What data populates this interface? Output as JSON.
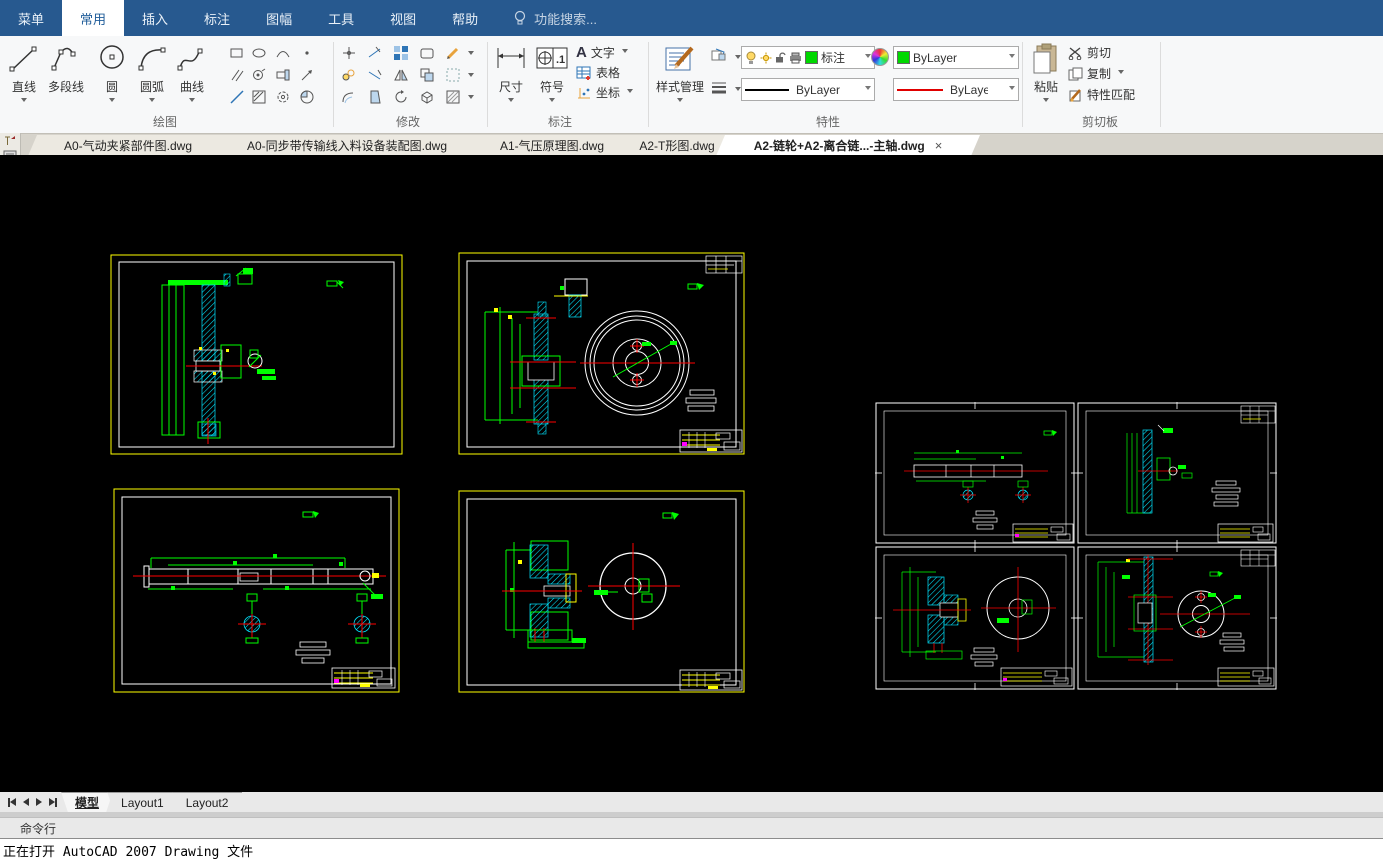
{
  "menu": {
    "items": [
      "菜单",
      "常用",
      "插入",
      "标注",
      "图幅",
      "工具",
      "视图",
      "帮助"
    ],
    "active_item": "常用",
    "search_placeholder": "功能搜索..."
  },
  "ribbon": {
    "draw": {
      "label": "绘图",
      "line": "直线",
      "polyline": "多段线",
      "circle": "圆",
      "arc": "圆弧",
      "curve": "曲线"
    },
    "modify": {
      "label": "修改"
    },
    "annotate": {
      "label": "标注",
      "dimension": "尺寸",
      "symbol": "符号",
      "symbol_icon_text": ".1",
      "text_icon": "A",
      "text": "文字",
      "table": "表格",
      "coordinate": "坐标"
    },
    "properties": {
      "label": "特性",
      "style_manager": "样式管理",
      "layer_value": "标注",
      "color_value": "ByLayer",
      "linetype_value": "ByLayer",
      "lineweight_value": "ByLayer"
    },
    "clipboard": {
      "label": "剪切板",
      "paste": "粘贴",
      "cut": "剪切",
      "copy": "复制",
      "match_properties": "特性匹配"
    }
  },
  "document_tabs": {
    "tabs": [
      {
        "label": "A0-气动夹紧部件图.dwg"
      },
      {
        "label": "A0-同步带传输线入料设备装配图.dwg"
      },
      {
        "label": "A1-气压原理图.dwg"
      },
      {
        "label": "A2-T形图.dwg"
      },
      {
        "label": "A2-链轮+A2-离合链...-主轴.dwg"
      }
    ],
    "active_label": "A2-链轮+A2-离合链...-主轴.dwg",
    "close_glyph": "×"
  },
  "layout_tabs": {
    "model": "模型",
    "layout1": "Layout1",
    "layout2": "Layout2",
    "active": "模型"
  },
  "command_panel": {
    "title": "命令行",
    "line": "正在打开 AutoCAD 2007 Drawing 文件"
  },
  "colors": {
    "menubar_blue": "#27598F",
    "canvas_black": "#000000",
    "sheet_border_yellow": "#FFFF00",
    "geometry_green": "#00FF00",
    "hatch_cyan": "#00E5FF",
    "centerline_red": "#FF0000",
    "geometry_white": "#FFFFFF",
    "layer_swatch_green": "#00D800",
    "title_block_magenta": "#FF00FF"
  }
}
